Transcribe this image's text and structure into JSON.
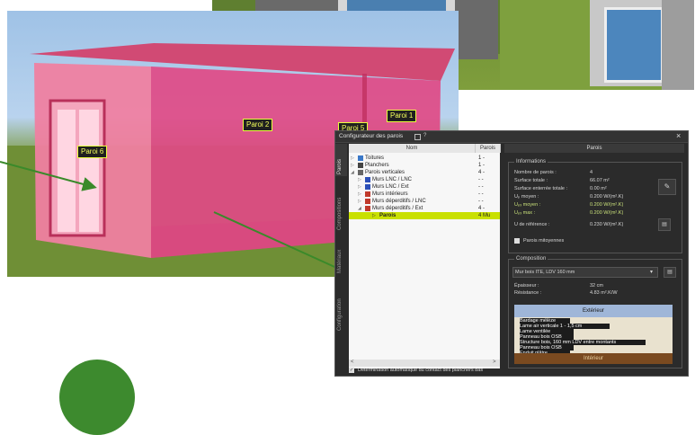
{
  "viewport": {
    "labels": [
      "Paroi 1",
      "Paroi 2",
      "Paroi 5",
      "Paroi 6"
    ]
  },
  "dialog": {
    "title": "Configurateur des parois",
    "close": "×",
    "vertical_tabs": [
      "Parois",
      "Compositions",
      "Matériaux",
      "Configuration"
    ],
    "tree": {
      "columns": [
        "Nom",
        "Parois"
      ],
      "rows": [
        {
          "label": "Toitures",
          "count": "1 -",
          "indent": 0,
          "icon": "roof",
          "color": "#3a78c8"
        },
        {
          "label": "Planchers",
          "count": "1 -",
          "indent": 0,
          "icon": "floor",
          "color": "#444444"
        },
        {
          "label": "Parois verticales",
          "count": "4 -",
          "indent": 0,
          "icon": "wall-group",
          "color": "#666666"
        },
        {
          "label": "Murs LNC / LNC",
          "count": "- -",
          "indent": 1,
          "icon": "wall",
          "color": "#2c4fb8"
        },
        {
          "label": "Murs LNC / Ext",
          "count": "- -",
          "indent": 1,
          "icon": "wall",
          "color": "#2c4fb8"
        },
        {
          "label": "Murs intérieurs",
          "count": "- -",
          "indent": 1,
          "icon": "wall",
          "color": "#c0392b"
        },
        {
          "label": "Murs déperditifs / LNC",
          "count": "- -",
          "indent": 1,
          "icon": "wall",
          "color": "#c0392b"
        },
        {
          "label": "Murs déperditifs / Ext",
          "count": "4 -",
          "indent": 1,
          "icon": "wall",
          "color": "#c0392b"
        },
        {
          "label": "Parois",
          "count": "4 Mu",
          "indent": 2,
          "icon": "item",
          "color": "#c9e000",
          "selected": true
        }
      ]
    },
    "right_header": "Parois",
    "informations": {
      "title": "Informations",
      "rows": [
        {
          "label": "Nombre de parois :",
          "value": "4",
          "hl": false
        },
        {
          "label": "Surface totale :",
          "value": "66.07 m²",
          "hl": false
        },
        {
          "label": "Surface enterrée totale :",
          "value": "0.00 m²",
          "hl": false
        },
        {
          "label": "Uₚ moyen :",
          "value": "0.200 W/(m².K)",
          "hl": false
        },
        {
          "label": "Uₚₓ moyen :",
          "value": "0.200 W/(m².K)",
          "hl": true
        },
        {
          "label": "Uₚₓ max :",
          "value": "0.200 W/(m².K)",
          "hl": true
        },
        {
          "label": "U de référence :",
          "value": "0.230 W/(m².K)",
          "hl": false
        }
      ],
      "checkbox_label": "Parois mitoyennes"
    },
    "composition": {
      "title": "Composition",
      "selected": "Mur bois ITE, LDV 160 mm",
      "epaisseur_label": "Épaisseur :",
      "epaisseur_value": "32 cm",
      "resistance_label": "Résistance :",
      "resistance_value": "4.83 m².K/W",
      "exterior": "Extérieur",
      "interior": "Intérieur",
      "layers": [
        "Bardage mélèze",
        "Lame air verticale 1 - 1,5 cm",
        "Lame ventilée",
        "Panneau bois OSB",
        "Structure bois, 160 mm LDV entre montants",
        "Panneau bois OSB",
        "Enduit plâtre"
      ]
    },
    "auto_checkbox": "Détermination automatique du contact des planchers bas"
  }
}
